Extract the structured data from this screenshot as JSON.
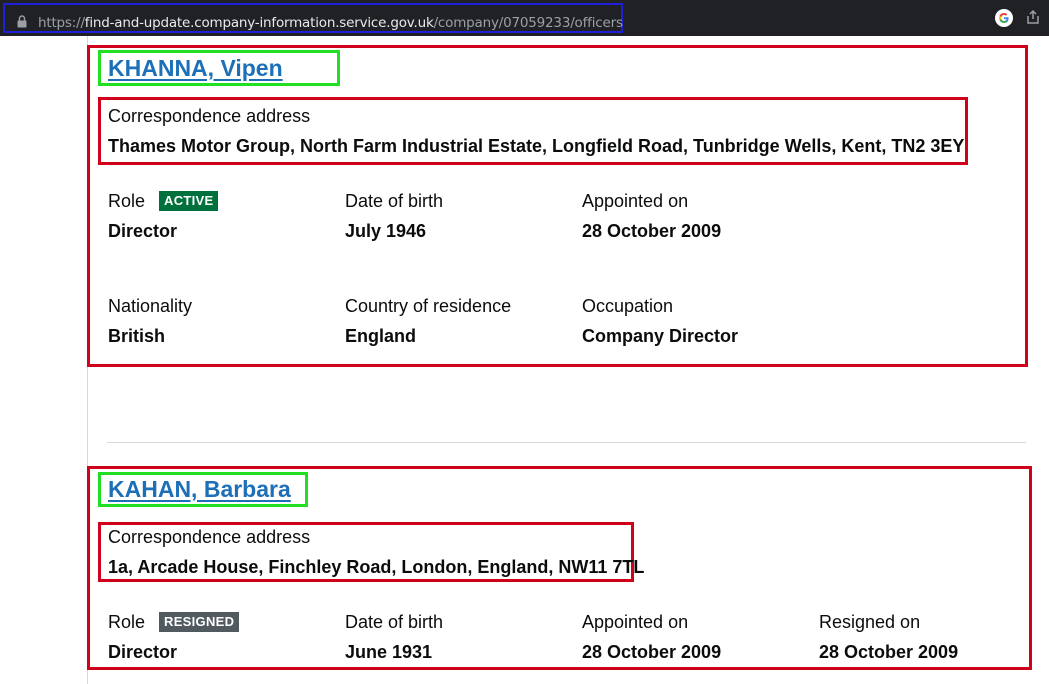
{
  "browser": {
    "url_scheme": "https://",
    "url_host": "find-and-update.company-information.service.gov.uk",
    "url_path": "/company/07059233/officers",
    "icons": {
      "lock": "lock-icon",
      "google": "google-icon",
      "share": "share-icon"
    }
  },
  "officers": [
    {
      "name": "KHANNA, Vipen",
      "address_label": "Correspondence address",
      "address": "Thames Motor Group, North Farm Industrial Estate, Longfield Road, Tunbridge Wells, Kent, TN2 3EY",
      "role_label": "Role",
      "status": "ACTIVE",
      "role": "Director",
      "dob_label": "Date of birth",
      "dob": "July 1946",
      "appointed_label": "Appointed on",
      "appointed": "28 October 2009",
      "nationality_label": "Nationality",
      "nationality": "British",
      "residence_label": "Country of residence",
      "residence": "England",
      "occupation_label": "Occupation",
      "occupation": "Company Director"
    },
    {
      "name": "KAHAN, Barbara",
      "address_label": "Correspondence address",
      "address": "1a, Arcade House, Finchley Road, London, England, NW11 7TL",
      "role_label": "Role",
      "status": "RESIGNED",
      "role": "Director",
      "dob_label": "Date of birth",
      "dob": "June 1931",
      "appointed_label": "Appointed on",
      "appointed": "28 October 2009",
      "resigned_label": "Resigned on",
      "resigned": "28 October 2009"
    }
  ],
  "colors": {
    "link": "#1d70b8",
    "active_tag": "#00703c",
    "resigned_tag": "#505a5f",
    "annotation_red": "#d0021b",
    "annotation_green": "#21e021",
    "annotation_blue": "#1f1fd8"
  }
}
